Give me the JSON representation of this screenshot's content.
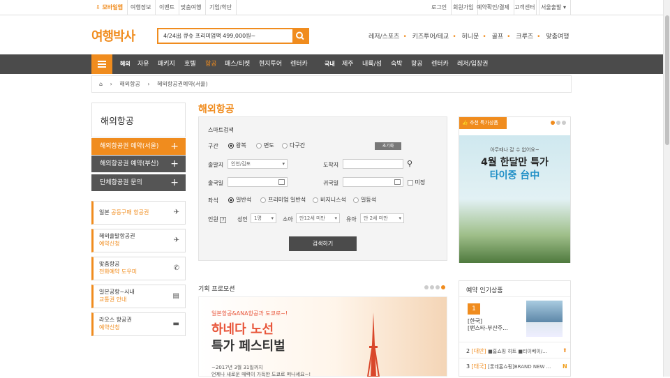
{
  "topbar": {
    "mobile": "모바일앱",
    "links_left": [
      "여행정보",
      "이벤트",
      "맞춤여행",
      "기업/학단"
    ],
    "links_right": [
      "로그인",
      "회원가입",
      "예약확인/결제",
      "고객센터"
    ],
    "departure": "서울출발"
  },
  "logo": "여행박사",
  "search": {
    "value": "4/24出 큐슈 프리미엄팩 499,000원~"
  },
  "toplinks": [
    "레저/스포츠",
    "키즈투어/테교",
    "허니문",
    "골프",
    "크루즈",
    "맞춤여행"
  ],
  "gnb": {
    "overseas_label": "해외",
    "overseas": [
      "자유",
      "패키지",
      "호텔",
      "항공",
      "패스/티켓",
      "현지투어",
      "렌터카"
    ],
    "domestic_label": "국내",
    "domestic": [
      "제주",
      "내륙/섬",
      "숙박",
      "항공",
      "렌터카",
      "레저/입장권"
    ]
  },
  "breadcrumb": [
    "해외항공",
    "해외항공권예약(서울)"
  ],
  "side": {
    "title": "해외항공",
    "buttons": [
      "해외항공권 예약(서울)",
      "해외항공권 예약(부산)",
      "단체항공권 문의"
    ],
    "cards": [
      {
        "line1": "일본",
        "line1b": "공동구매 항공권",
        "line2": ""
      },
      {
        "line1": "해외출발항공권",
        "line2": "예약신청"
      },
      {
        "line1": "맞춤항공",
        "line2": "전화예약 도우미"
      },
      {
        "line1": "일본공항~시내",
        "line2": "교통권 안내"
      },
      {
        "line1": "라오스 항공권",
        "line2": "예약신청"
      }
    ]
  },
  "main": {
    "title": "해외항공"
  },
  "form": {
    "title": "스마트검색",
    "section_label": "구간",
    "trip_types": [
      "왕복",
      "편도",
      "다구간"
    ],
    "reset": "초기화",
    "depart_label": "출발지",
    "depart_value": "인천/김포",
    "arrive_label": "도착지",
    "depdate_label": "출국일",
    "retdate_label": "귀국일",
    "undecided": "미정",
    "seat_label": "좌석",
    "seats": [
      "일반석",
      "프리미엄 일반석",
      "비지니스석",
      "일등석"
    ],
    "pax_label": "인원",
    "adult_label": "성인",
    "adult_value": "1명",
    "child_label": "소아",
    "child_value": "만12세 미만",
    "infant_label": "유아",
    "infant_value": "만 2세 미만",
    "search_button": "검색하기"
  },
  "ad": {
    "tag": "추천 특가상품",
    "line1": "아무때나 갈 수 없어요~",
    "line2": "4월 한달만 특가",
    "line3": "타이중 台中"
  },
  "promo": {
    "title": "기획 프로모션",
    "line1": "일본항공&ANA항공과 도쿄로~!",
    "line2": "하네다 노선",
    "line3": "특가 페스티벌",
    "line4": "~2017년 3월 31일까지",
    "line5": "언제나 새로운 매력이 가득한 도쿄로 떠나세요~!"
  },
  "popular": {
    "title": "예약 인기상품",
    "items": [
      {
        "rank": "1",
        "name": "[한국]",
        "desc": "[팬스타-부산주..."
      },
      {
        "rank": "2",
        "name": "[대만]",
        "desc": "■홈쇼핑 히트 ■티이베이/..."
      },
      {
        "rank": "3",
        "name": "[태국]",
        "desc": "[롯데홈쇼핑]BRAND NEW ..."
      }
    ]
  },
  "colors": {
    "accent": "#f08c1e",
    "nav": "#4b4b4b"
  }
}
